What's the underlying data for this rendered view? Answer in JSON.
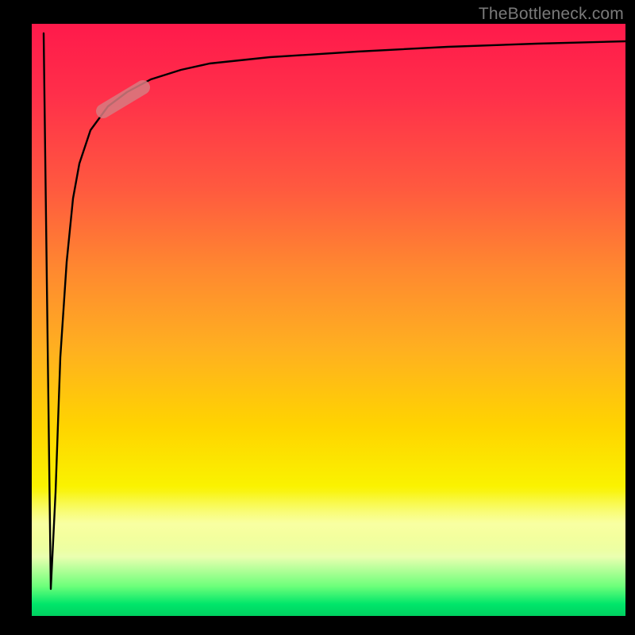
{
  "watermark": "TheBottleneck.com",
  "colors": {
    "frame": "#000000",
    "curve": "#000000",
    "marker_fill": "#d77b80",
    "gradient_top": "#ff1a4b",
    "gradient_mid1": "#ff8a2f",
    "gradient_mid2": "#ffd400",
    "gradient_bottom": "#00d060"
  },
  "chart_data": {
    "type": "line",
    "title": "",
    "xlabel": "",
    "ylabel": "",
    "xlim": [
      0,
      100
    ],
    "ylim": [
      0,
      100
    ],
    "grid": false,
    "legend": false,
    "series": [
      {
        "name": "curve",
        "x": [
          2,
          3,
          4,
          5,
          6,
          7,
          8,
          10,
          13,
          16,
          20,
          25,
          30,
          40,
          55,
          70,
          85,
          100
        ],
        "y": [
          98,
          5,
          20,
          45,
          60,
          70,
          76,
          82,
          86,
          88.5,
          90.5,
          92,
          93,
          94.2,
          95.2,
          96,
          96.6,
          97
        ]
      }
    ],
    "marker": {
      "name": "highlight-segment",
      "x_range": [
        12,
        18
      ],
      "y_range": [
        85.5,
        89
      ],
      "shape": "capsule"
    },
    "background_gradient": {
      "direction": "vertical",
      "stops": [
        {
          "pos": 0,
          "color": "#ff1a4b"
        },
        {
          "pos": 28,
          "color": "#ff5a3f"
        },
        {
          "pos": 55,
          "color": "#ffb020"
        },
        {
          "pos": 78,
          "color": "#faf200"
        },
        {
          "pos": 95,
          "color": "#6cff7a"
        },
        {
          "pos": 100,
          "color": "#00d060"
        }
      ]
    }
  }
}
